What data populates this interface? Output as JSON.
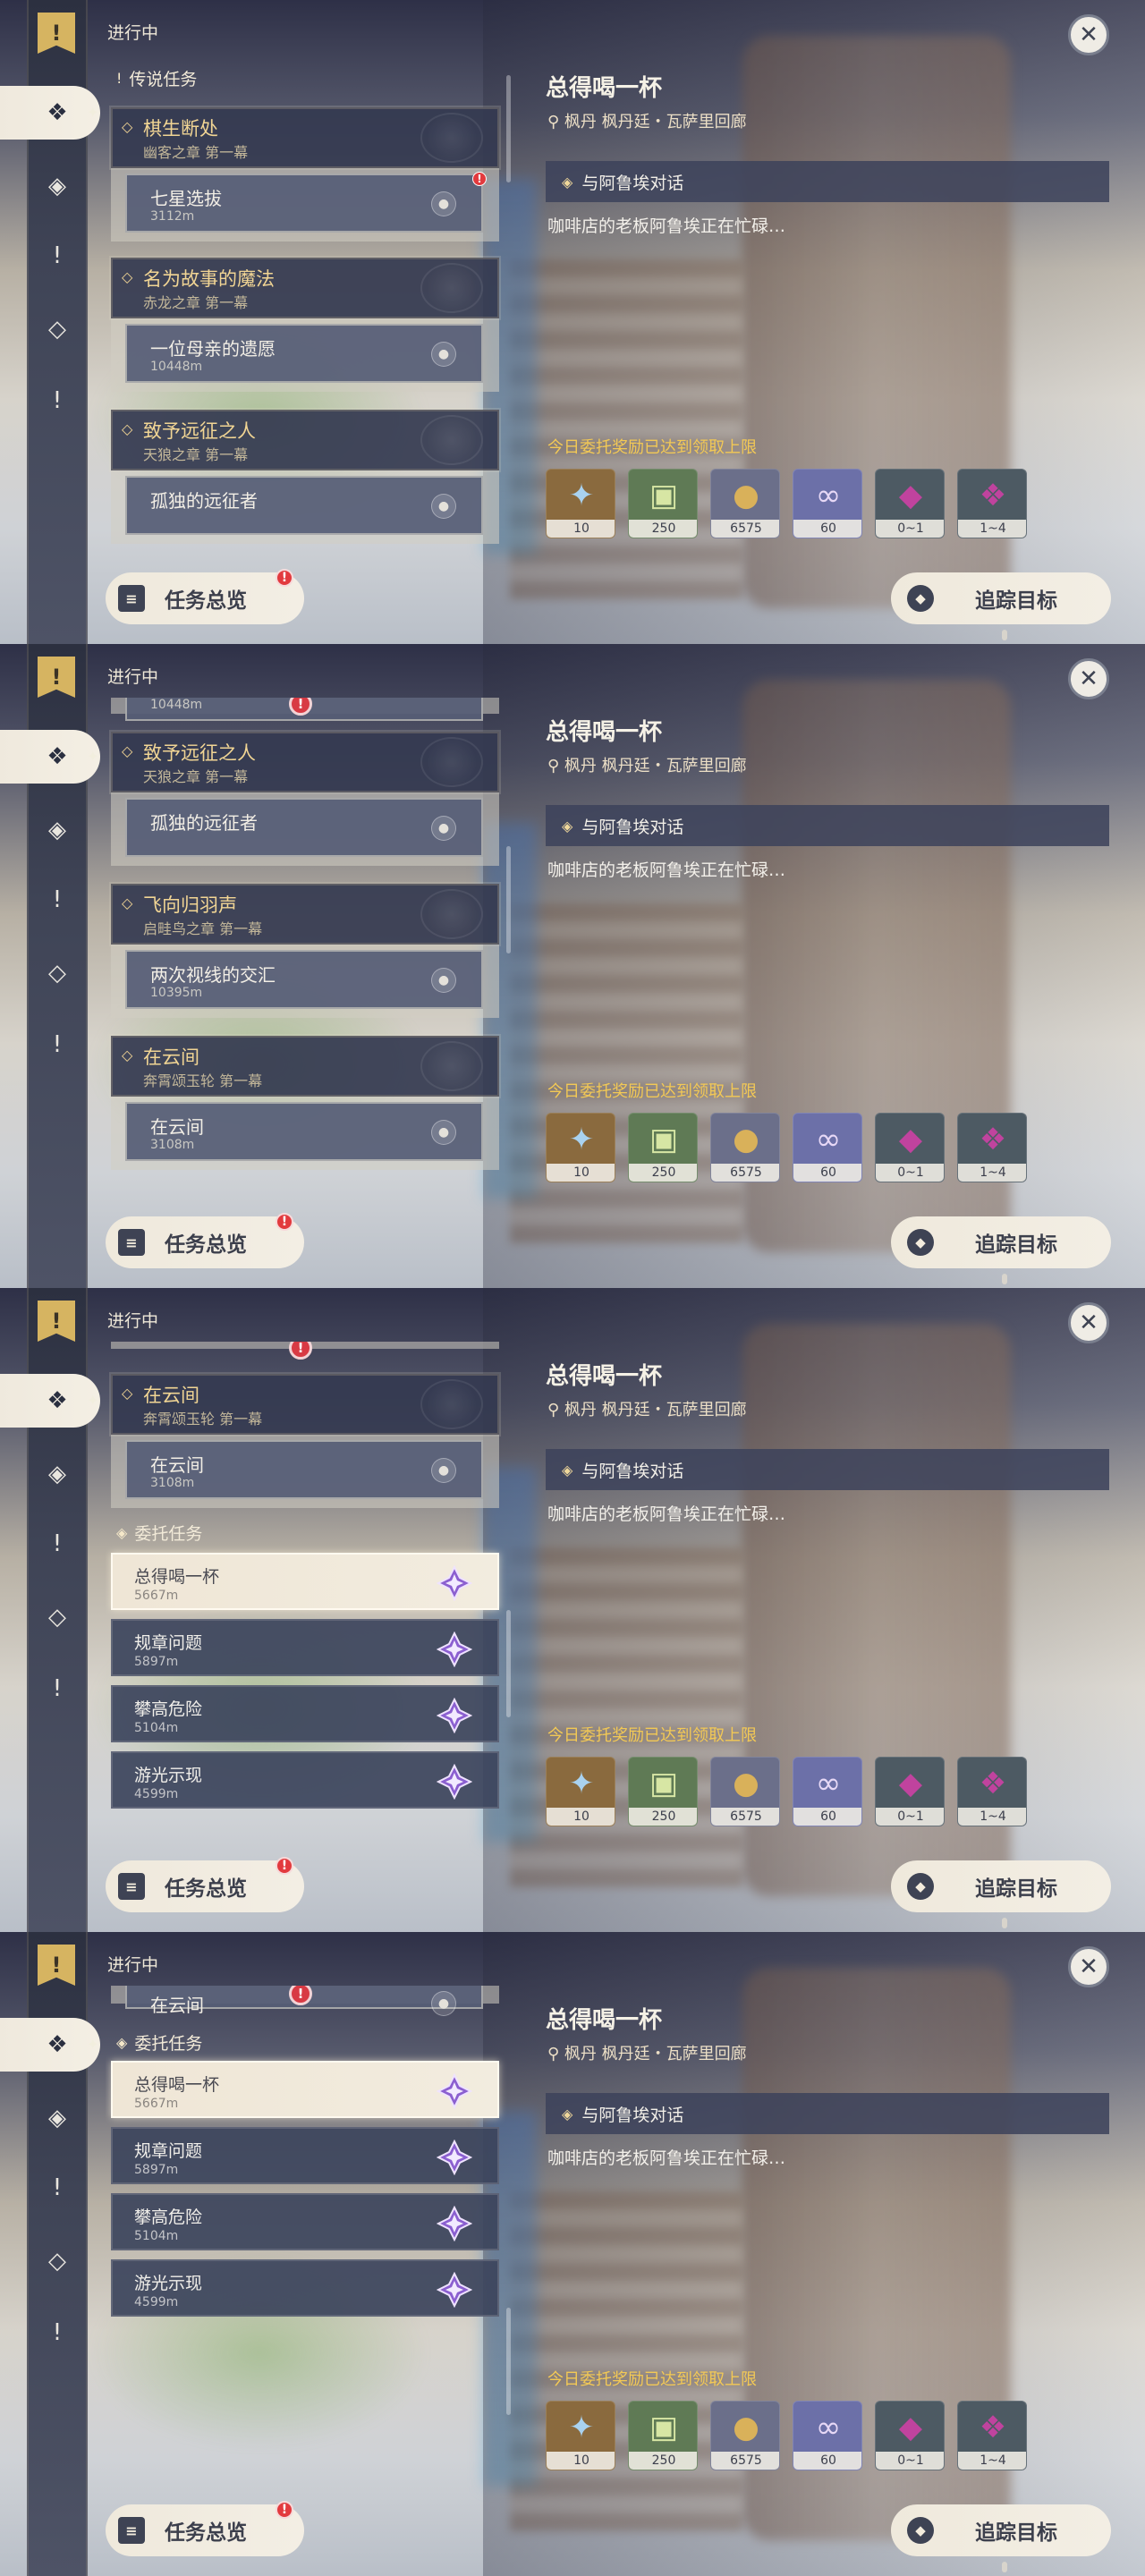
{
  "colors": {
    "gold": "#f1d594",
    "limit_yellow": "#f3c955",
    "badge_red": "#e23a3e",
    "chapter_bg": "#343a50",
    "selected_bg": "#efe6d6"
  },
  "header": {
    "status": "进行中"
  },
  "detail": {
    "title": "总得喝一杯",
    "location": "枫丹 枫丹廷・瓦萨里回廊",
    "objective": "与阿鲁埃对话",
    "description": "咖啡店的老板阿鲁埃正在忙碌…",
    "reward_limit_notice": "今日委托奖励已达到领取上限",
    "rewards": [
      {
        "icon": "primogem-icon",
        "amount": "10",
        "bg": "#8a6a3e"
      },
      {
        "icon": "adventure-exp-icon",
        "amount": "250",
        "bg": "#5f7a55"
      },
      {
        "icon": "mora-icon",
        "amount": "6575",
        "bg": "#6b6f8a"
      },
      {
        "icon": "companionship-icon",
        "amount": "60",
        "bg": "#6c70a8"
      },
      {
        "icon": "crystal-icon",
        "amount": "0~1",
        "bg": "#4d5a63"
      },
      {
        "icon": "crystal-cluster-icon",
        "amount": "1~4",
        "bg": "#4d5a63"
      }
    ]
  },
  "buttons": {
    "overview": "任务总览",
    "track": "追踪目标",
    "overview_badge": "!"
  },
  "sections": {
    "legend": "传说任务",
    "commission": "委托任务"
  },
  "chapters": [
    {
      "title": "棋生断处",
      "sub": "幽客之章 第一幕",
      "quest": "七星选拔",
      "dist": "3112m"
    },
    {
      "title": "名为故事的魔法",
      "sub": "赤龙之章 第一幕",
      "quest": "一位母亲的遗愿",
      "dist": "10448m"
    },
    {
      "title": "致予远征之人",
      "sub": "天狼之章 第一幕",
      "quest": "孤独的远征者",
      "dist": ""
    },
    {
      "title": "飞向归羽声",
      "sub": "启畦鸟之章 第一幕",
      "quest": "两次视线的交汇",
      "dist": "10395m"
    },
    {
      "title": "在云间",
      "sub": "奔霄颂玉轮 第一幕",
      "quest": "在云间",
      "dist": "3108m"
    }
  ],
  "partial": {
    "p2": "10448m",
    "p4": "在云间"
  },
  "commissions": [
    {
      "title": "总得喝一杯",
      "dist": "5667m"
    },
    {
      "title": "规章问题",
      "dist": "5897m"
    },
    {
      "title": "攀高危险",
      "dist": "5104m"
    },
    {
      "title": "游光示现",
      "dist": "4599m"
    }
  ]
}
